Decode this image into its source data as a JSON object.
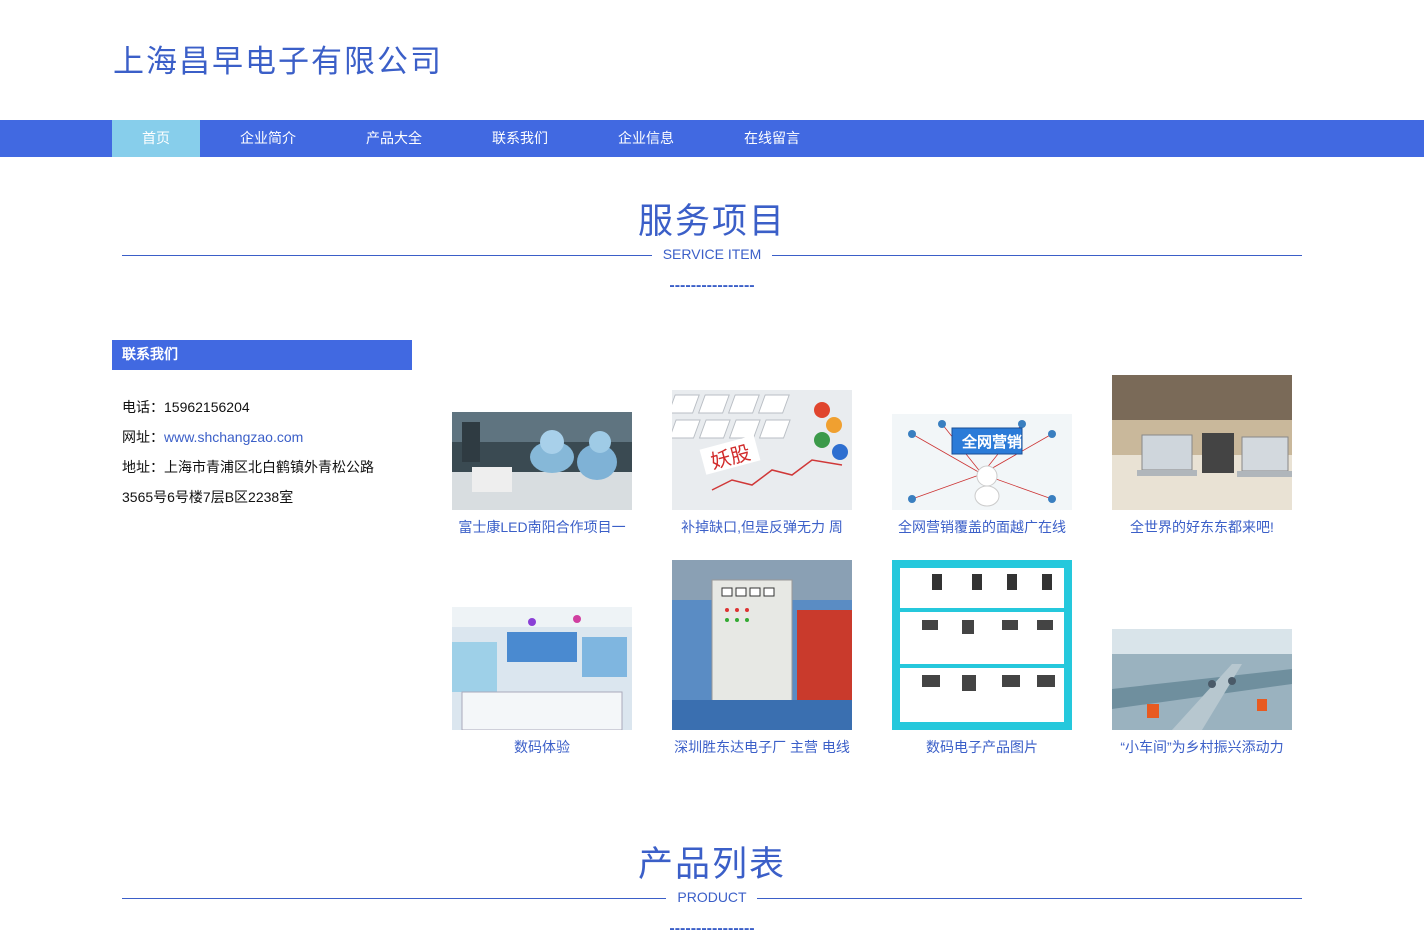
{
  "site": {
    "title": "上海昌早电子有限公司"
  },
  "nav": {
    "items": [
      {
        "label": "首页",
        "active": true
      },
      {
        "label": "企业简介",
        "active": false
      },
      {
        "label": "产品大全",
        "active": false
      },
      {
        "label": "联系我们",
        "active": false
      },
      {
        "label": "企业信息",
        "active": false
      },
      {
        "label": "在线留言",
        "active": false
      }
    ]
  },
  "services": {
    "title": "服务项目",
    "subtitle": "SERVICE ITEM",
    "dashes": "----------------"
  },
  "sidebar": {
    "heading": "联系我们",
    "phone_label": "电话：",
    "phone": "15962156204",
    "web_label": "网址：",
    "web": "www.shchangzao.com",
    "addr_label": "地址：",
    "addr_line1": "上海市青浦区北白鹤镇外青松公路",
    "addr_line2": "3565号6号楼7层B区2238室"
  },
  "products": [
    {
      "caption": "富士康LED南阳合作项目一",
      "image": "factory-workers-photo"
    },
    {
      "caption": "补掉缺口,但是反弹无力 周",
      "image": "keyboard-stock-photo",
      "image_text": "妖股"
    },
    {
      "caption": "全网营销覆盖的面越广在线",
      "image": "network-marketing-photo",
      "image_text": "全网营销"
    },
    {
      "caption": "全世界的好东东都来吧!",
      "image": "electronics-store-photo"
    },
    {
      "caption": "数码体验",
      "image": "digital-shop-photo"
    },
    {
      "caption": "深圳胜东达电子厂 主营 电线",
      "image": "control-cabinet-photo"
    },
    {
      "caption": "数码电子产品图片",
      "image": "product-catalog-photo"
    },
    {
      "caption": "“小车间”为乡村振兴添动力",
      "image": "assembly-line-photo"
    }
  ],
  "product_list": {
    "title": "产品列表",
    "subtitle": "PRODUCT",
    "dashes": "----------------"
  },
  "colors": {
    "brand_blue": "#4169e1",
    "nav_active": "#87ceeb",
    "text_blue": "#3b5fc8"
  }
}
